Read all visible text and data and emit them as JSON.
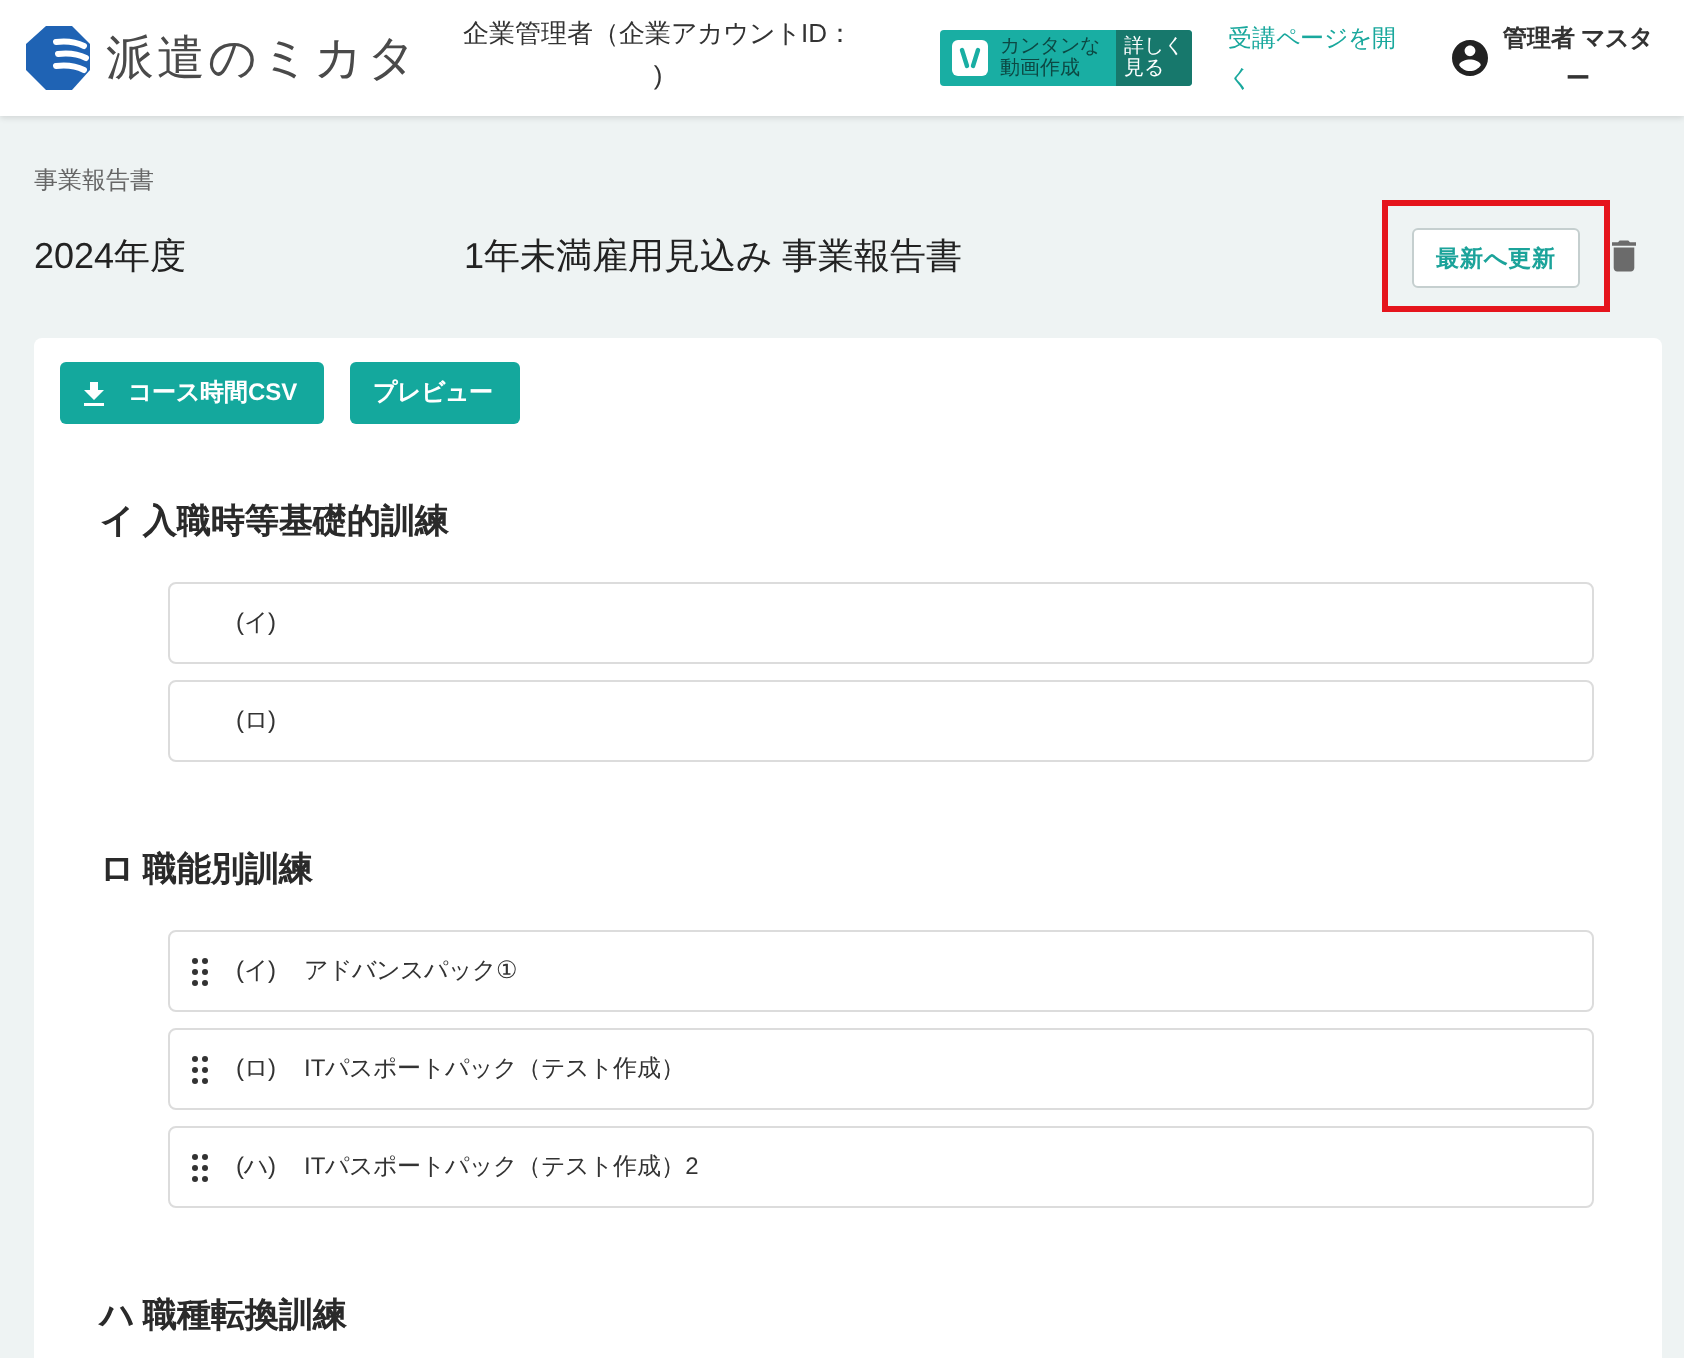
{
  "header": {
    "logo_text": "派遣のミカタ",
    "account_label": "企業管理者（企業アカウントID： )",
    "promo_banner": {
      "text": "カンタンな動画作成",
      "more": "詳しく見る"
    },
    "course_link": "受講ページを開く",
    "user_name": "管理者 マスター"
  },
  "breadcrumb": "事業報告書",
  "title_row": {
    "fiscal_year": "2024年度",
    "report_title": "1年未満雇用見込み 事業報告書",
    "refresh_button": {
      "label": "最新へ更新",
      "highlighted": true
    }
  },
  "toolbar": [
    {
      "kind": "download",
      "label": "コース時間CSV"
    },
    {
      "kind": "plain",
      "label": "プレビュー"
    }
  ],
  "sections": [
    {
      "heading": "イ 入職時等基礎的訓練",
      "items": [
        {
          "number": "(イ)",
          "draggable": false
        },
        {
          "number": "(ロ)",
          "draggable": false
        }
      ]
    },
    {
      "heading": "ロ 職能別訓練",
      "items": [
        {
          "number": "(イ)",
          "title": "アドバンスパック①",
          "draggable": true
        },
        {
          "number": "(ロ)",
          "title": "ITパスポートパック（テスト作成）",
          "draggable": true
        },
        {
          "number": "(ハ)",
          "title": "ITパスポートパック（テスト作成）2",
          "draggable": true
        }
      ]
    },
    {
      "heading": "ハ 職種転換訓練"
    }
  ]
}
